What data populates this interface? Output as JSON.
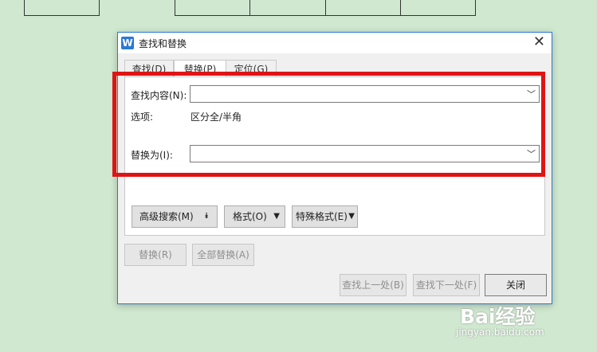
{
  "dialog": {
    "title": "查找和替换",
    "app_icon_glyph": "W"
  },
  "tabs": [
    {
      "label": "查找(D)"
    },
    {
      "label": "替换(P)"
    },
    {
      "label": "定位(G)"
    }
  ],
  "find": {
    "label": "查找内容(N):",
    "value": ""
  },
  "options": {
    "label": "选项:",
    "value": "区分全/半角"
  },
  "replace": {
    "label": "替换为(I):",
    "value": ""
  },
  "panel_buttons": {
    "advanced": "高级搜索(M)",
    "format": "格式(O)",
    "special": "特殊格式(E)"
  },
  "action_buttons": {
    "replace": "替换(R)",
    "replace_all": "全部替换(A)",
    "find_prev": "查找上一处(B)",
    "find_next": "查找下一处(F)",
    "close": "关闭"
  },
  "watermark": {
    "logo": "Bai经验",
    "url": "jingyan.baidu.com"
  },
  "colors": {
    "highlight": "#e01414",
    "accent": "#2b78d6"
  }
}
